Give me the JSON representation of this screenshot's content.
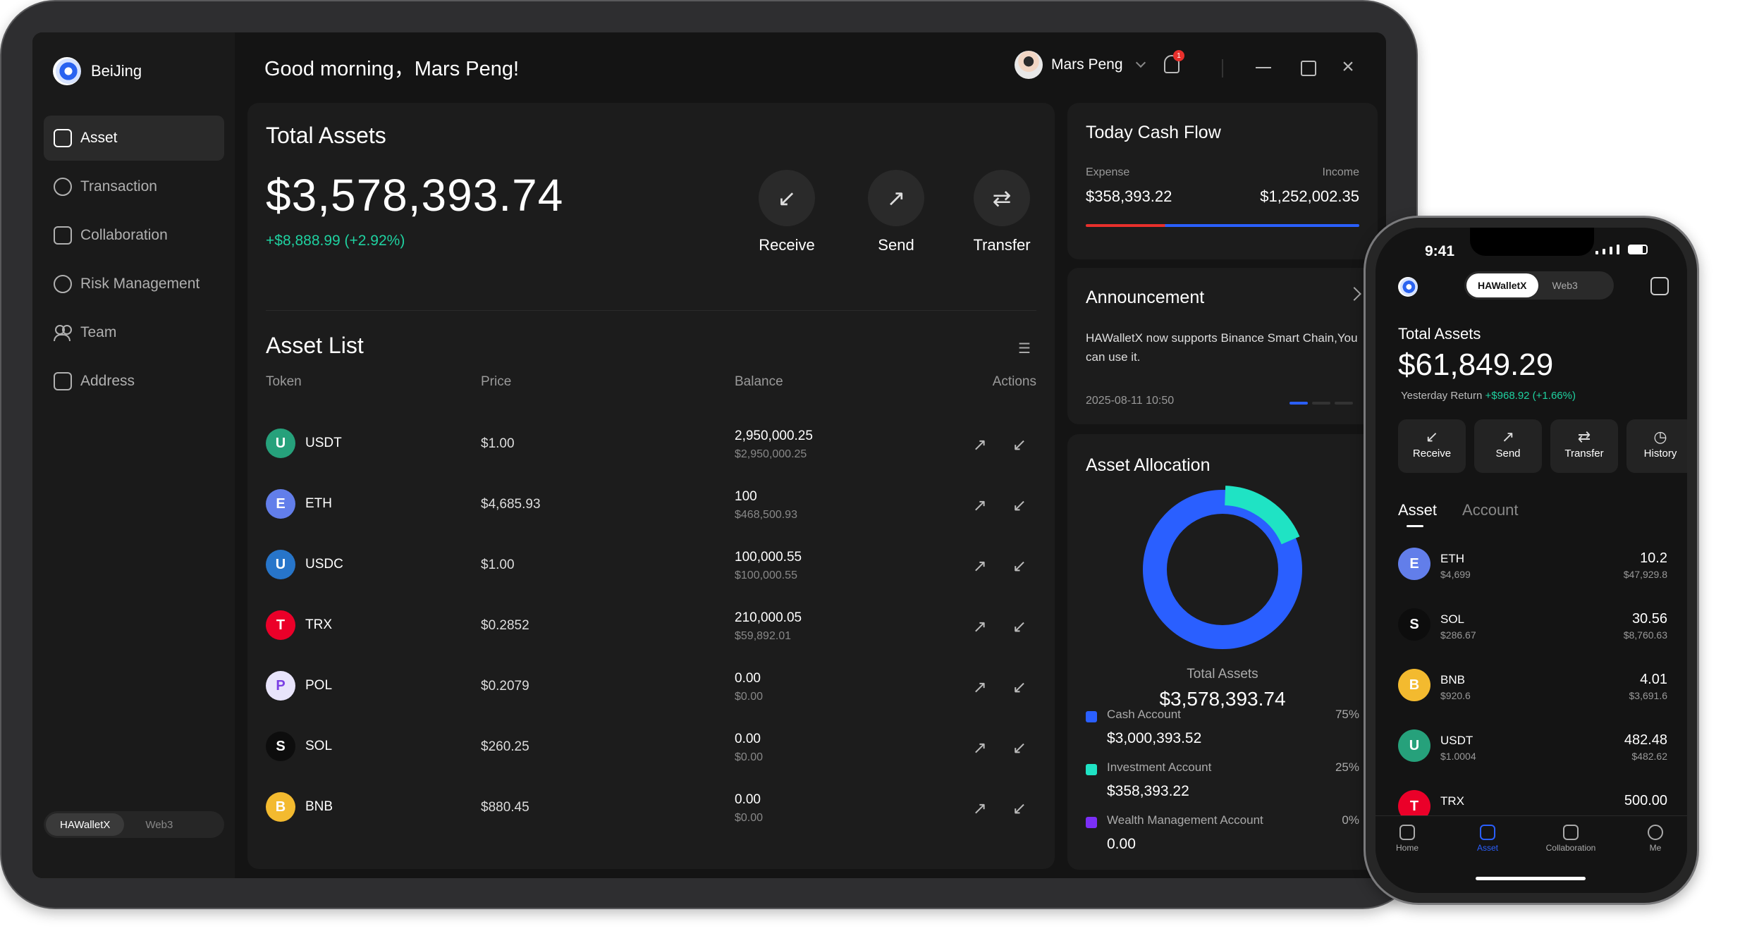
{
  "sidebar": {
    "brand": "BeiJing",
    "items": [
      {
        "label": "Asset"
      },
      {
        "label": "Transaction"
      },
      {
        "label": "Collaboration"
      },
      {
        "label": "Risk Management"
      },
      {
        "label": "Team"
      },
      {
        "label": "Address"
      }
    ],
    "switch": {
      "on": "HAWalletX",
      "off": "Web3"
    }
  },
  "header": {
    "greeting": "Good morning，Mars Peng!",
    "user": "Mars Peng",
    "notif_count": "1"
  },
  "total": {
    "title": "Total Assets",
    "amount": "$3,578,393.74",
    "change": "+$8,888.99 (+2.92%)",
    "actions": [
      {
        "label": "Receive"
      },
      {
        "label": "Send"
      },
      {
        "label": "Transfer"
      }
    ]
  },
  "asset_list": {
    "title": "Asset List",
    "columns": [
      "Token",
      "Price",
      "Balance",
      "Actions"
    ],
    "rows": [
      {
        "token": "USDT",
        "price": "$1.00",
        "balance": "2,950,000.25",
        "value": "$2,950,000.25",
        "color": "#26a17b"
      },
      {
        "token": "ETH",
        "price": "$4,685.93",
        "balance": "100",
        "value": "$468,500.93",
        "color": "#627eea"
      },
      {
        "token": "USDC",
        "price": "$1.00",
        "balance": "100,000.55",
        "value": "$100,000.55",
        "color": "#2775ca"
      },
      {
        "token": "TRX",
        "price": "$0.2852",
        "balance": "210,000.05",
        "value": "$59,892.01",
        "color": "#eb0029"
      },
      {
        "token": "POL",
        "price": "$0.2079",
        "balance": "0.00",
        "value": "$0.00",
        "color": "#e8e4fb"
      },
      {
        "token": "SOL",
        "price": "$260.25",
        "balance": "0.00",
        "value": "$0.00",
        "color": "#0d0d0d"
      },
      {
        "token": "BNB",
        "price": "$880.45",
        "balance": "0.00",
        "value": "$0.00",
        "color": "#f3ba2f"
      }
    ]
  },
  "cashflow": {
    "title": "Today Cash Flow",
    "expense_label": "Expense",
    "expense": "$358,393.22",
    "income_label": "Income",
    "income": "$1,252,002.35"
  },
  "announcement": {
    "title": "Announcement",
    "text": "HAWalletX now supports Binance Smart Chain,You can use it.",
    "date": "2025-08-11 10:50"
  },
  "allocation": {
    "title": "Asset Allocation",
    "total_label": "Total Assets",
    "total": "$3,578,393.74",
    "items": [
      {
        "name": "Cash Account",
        "pct": "75%",
        "value": "$3,000,393.52",
        "color": "#2a5fff",
        "share": 0.75
      },
      {
        "name": "Investment Account",
        "pct": "25%",
        "value": "$358,393.22",
        "color": "#1fe3c4",
        "share": 0.25
      },
      {
        "name": "Wealth Management Account",
        "pct": "0%",
        "value": "0.00",
        "color": "#7b2ff7",
        "share": 0
      }
    ]
  },
  "phone": {
    "time": "9:41",
    "switch": {
      "on": "HAWalletX",
      "off": "Web3"
    },
    "title": "Total Assets",
    "amount": "$61,849.29",
    "return_label": "Yesterday Return",
    "return": "+$968.92 (+1.66%)",
    "actions": [
      {
        "label": "Receive"
      },
      {
        "label": "Send"
      },
      {
        "label": "Transfer"
      },
      {
        "label": "History"
      }
    ],
    "tabs": [
      "Asset",
      "Account"
    ],
    "rows": [
      {
        "token": "ETH",
        "price": "$4,699",
        "amount": "10.2",
        "value": "$47,929.8",
        "color": "#627eea"
      },
      {
        "token": "SOL",
        "price": "$286.67",
        "amount": "30.56",
        "value": "$8,760.63",
        "color": "#0d0d0d"
      },
      {
        "token": "BNB",
        "price": "$920.6",
        "amount": "4.01",
        "value": "$3,691.6",
        "color": "#f3ba2f"
      },
      {
        "token": "USDT",
        "price": "$1.0004",
        "amount": "482.48",
        "value": "$482.62",
        "color": "#26a17b"
      },
      {
        "token": "TRX",
        "price": "",
        "amount": "500.00",
        "value": "",
        "color": "#eb0029"
      }
    ],
    "nav": [
      "Home",
      "Asset",
      "Collaboration",
      "Me"
    ]
  }
}
